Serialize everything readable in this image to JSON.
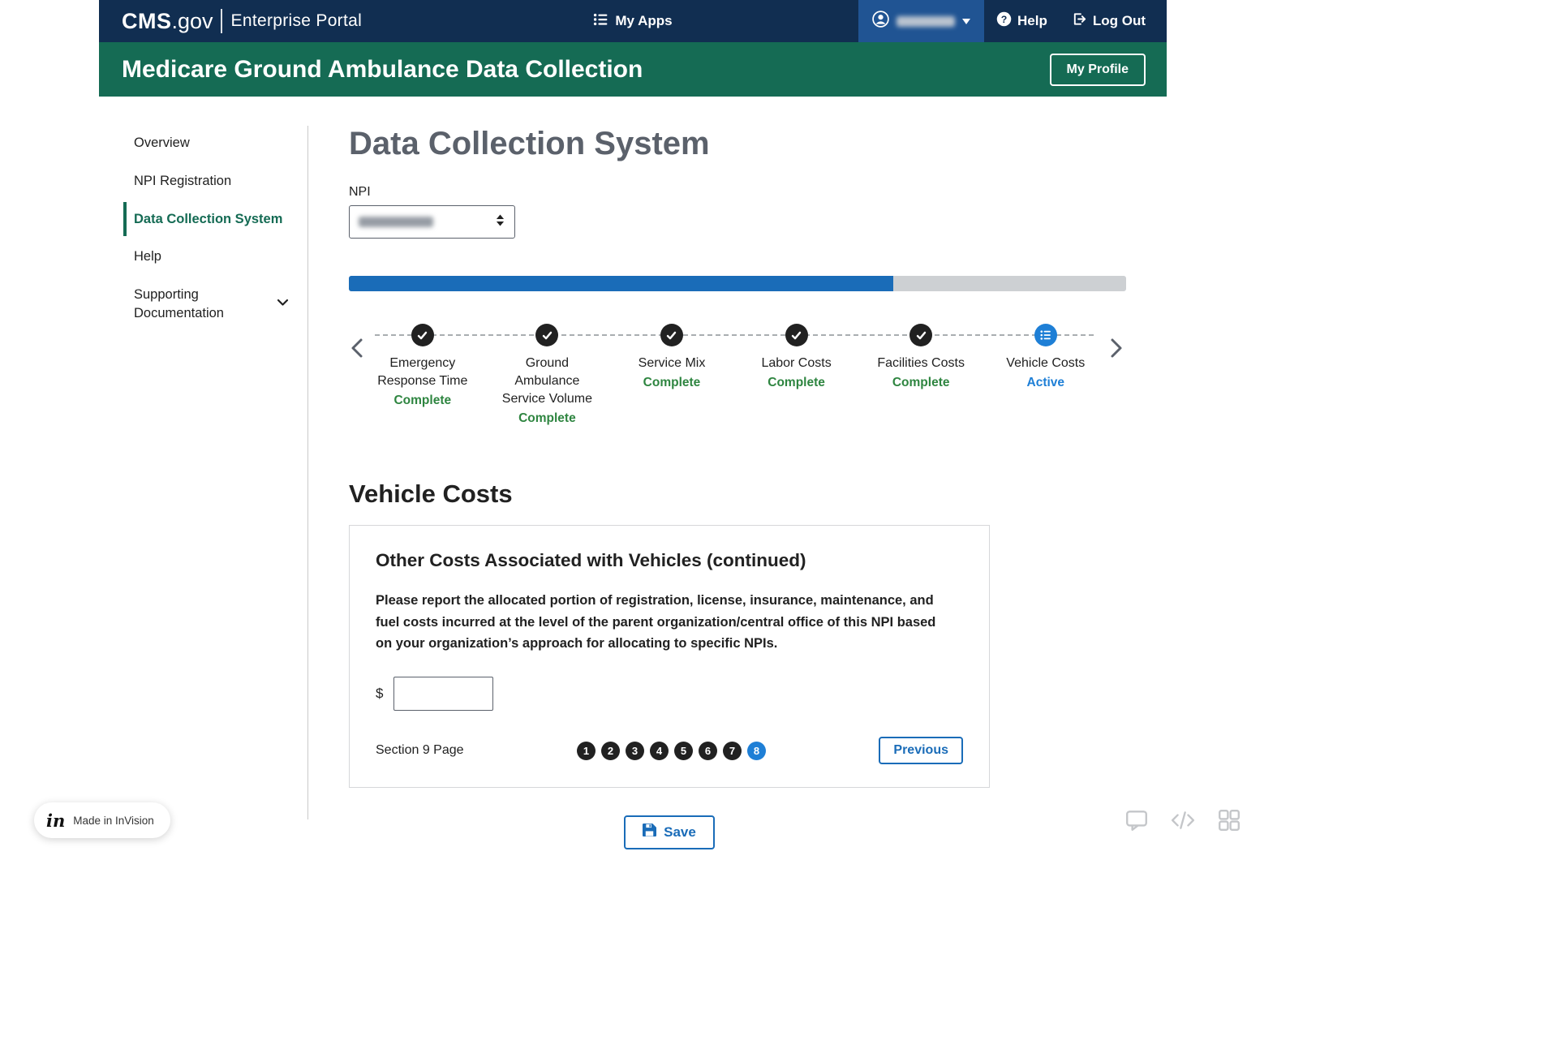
{
  "header": {
    "logo_cms": "CMS",
    "logo_gov": ".gov",
    "portal": "Enterprise Portal",
    "my_apps": "My Apps",
    "help": "Help",
    "logout": "Log Out"
  },
  "banner": {
    "title": "Medicare Ground Ambulance Data Collection",
    "my_profile": "My Profile"
  },
  "sidebar": {
    "items": [
      {
        "label": "Overview"
      },
      {
        "label": "NPI Registration"
      },
      {
        "label": "Data Collection System"
      },
      {
        "label": "Help"
      },
      {
        "label": "Supporting Documentation"
      }
    ]
  },
  "main": {
    "title": "Data Collection System",
    "npi_label": "NPI",
    "progress_percent": 70,
    "stepper": [
      {
        "label": "Emergency Response Time",
        "status": "Complete"
      },
      {
        "label": "Ground Ambulance Service Volume",
        "status": "Complete"
      },
      {
        "label": "Service Mix",
        "status": "Complete"
      },
      {
        "label": "Labor Costs",
        "status": "Complete"
      },
      {
        "label": "Facilities Costs",
        "status": "Complete"
      },
      {
        "label": "Vehicle Costs",
        "status": "Active"
      }
    ],
    "section_title": "Vehicle Costs",
    "card": {
      "title": "Other Costs Associated with Vehicles (continued)",
      "body": "Please report the allocated portion of registration, license, insurance, maintenance, and fuel costs incurred at the level of the parent organization/central office of this NPI based on your organization’s approach for allocating to specific NPIs.",
      "currency_symbol": "$",
      "amount_value": "",
      "section_page_label": "Section 9 Page",
      "pages": [
        "1",
        "2",
        "3",
        "4",
        "5",
        "6",
        "7",
        "8"
      ],
      "active_page": "8",
      "previous_label": "Previous"
    },
    "save_label": "Save"
  },
  "footer": {
    "invision_logo": "in",
    "invision_label": "Made in InVision"
  },
  "colors": {
    "header_navy": "#112e51",
    "user_menu_blue": "#205493",
    "banner_green": "#156b54",
    "accent_blue": "#1a6cb8",
    "active_blue": "#1e7fd6",
    "complete_green": "#2e8540",
    "progress_track": "#cdd0d3"
  }
}
